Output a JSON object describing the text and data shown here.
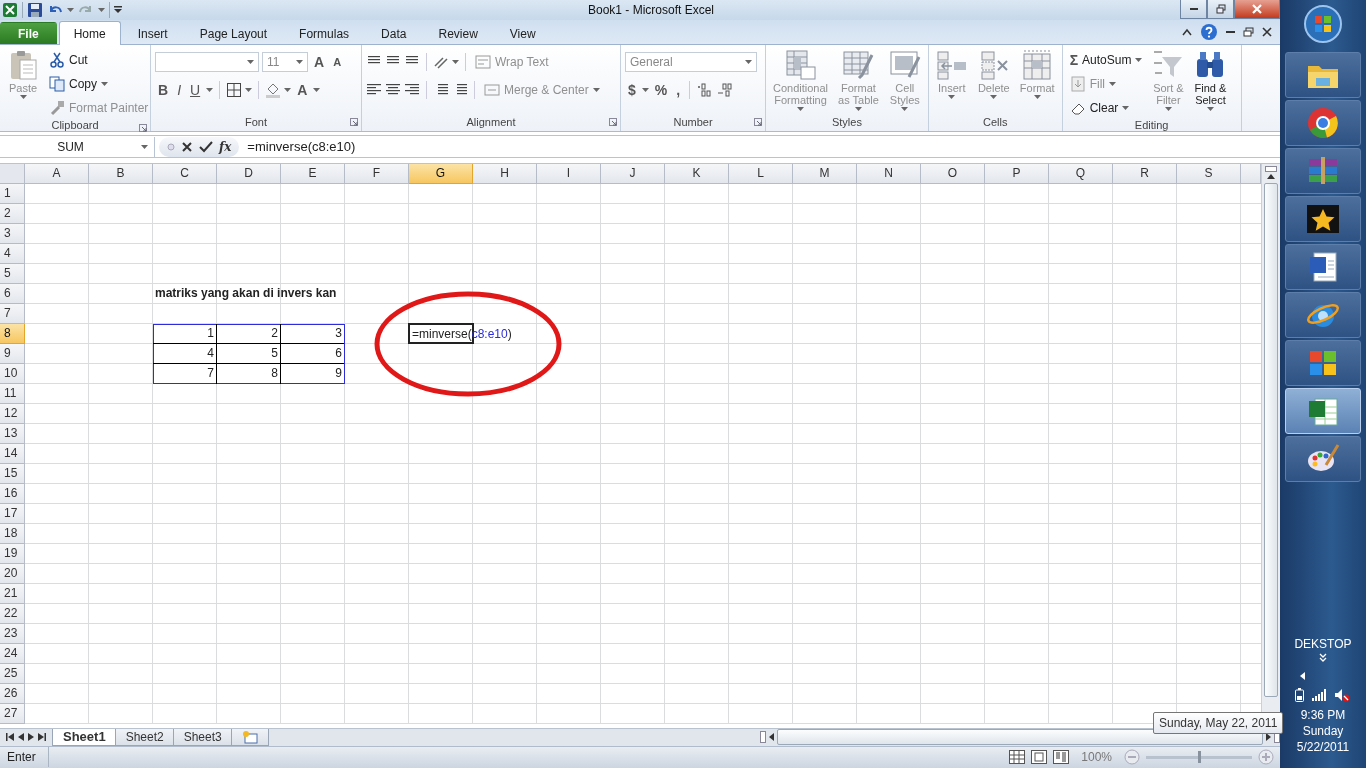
{
  "window": {
    "title": "Book1  -  Microsoft Excel"
  },
  "ribbon_tabs": [
    {
      "label": "File",
      "kind": "file",
      "selected": false
    },
    {
      "label": "Home",
      "kind": "tab",
      "selected": true
    },
    {
      "label": "Insert",
      "kind": "tab",
      "selected": false
    },
    {
      "label": "Page Layout",
      "kind": "tab",
      "selected": false
    },
    {
      "label": "Formulas",
      "kind": "tab",
      "selected": false
    },
    {
      "label": "Data",
      "kind": "tab",
      "selected": false
    },
    {
      "label": "Review",
      "kind": "tab",
      "selected": false
    },
    {
      "label": "View",
      "kind": "tab",
      "selected": false
    }
  ],
  "ribbon": {
    "groups": [
      {
        "kind": "clipboard",
        "label": "Clipboard",
        "paste": {
          "label": "Paste",
          "disabled": true
        },
        "cut": {
          "label": "Cut",
          "disabled": false
        },
        "copy": {
          "label": "Copy",
          "disabled": false
        },
        "format_painter": {
          "label": "Format Painter",
          "disabled": true
        }
      },
      {
        "kind": "font",
        "label": "Font",
        "font_size": "11",
        "grow_font": "A",
        "shrink_font": "A",
        "bold": "B",
        "italic": "I",
        "underline": "U",
        "font_color": "A"
      },
      {
        "kind": "alignment",
        "label": "Alignment",
        "wrap_text": {
          "label": "Wrap Text",
          "disabled": true
        },
        "merge": {
          "label": "Merge & Center",
          "disabled": true
        }
      },
      {
        "kind": "number",
        "label": "Number",
        "format": "General",
        "currency": "$",
        "percent": "%",
        "comma": ","
      },
      {
        "kind": "large",
        "label": "Styles",
        "buttons": [
          {
            "kind": "conditional",
            "label": "Conditional\nFormatting",
            "disabled": true
          },
          {
            "kind": "table",
            "label": "Format\nas Table",
            "disabled": true
          },
          {
            "kind": "styles",
            "label": "Cell\nStyles",
            "disabled": true
          }
        ]
      },
      {
        "kind": "large",
        "label": "Cells",
        "buttons": [
          {
            "kind": "insert",
            "label": "Insert",
            "disabled": true
          },
          {
            "kind": "delete",
            "label": "Delete",
            "disabled": true
          },
          {
            "kind": "format",
            "label": "Format",
            "disabled": true
          }
        ]
      },
      {
        "kind": "editing",
        "label": "Editing",
        "autosum": {
          "glyph": "Σ",
          "label": "AutoSum",
          "disabled": false
        },
        "fill": {
          "label": "Fill",
          "disabled": true
        },
        "clear": {
          "label": "Clear",
          "disabled": false
        },
        "sort": {
          "label": "Sort &\nFilter",
          "disabled": true
        },
        "find": {
          "label": "Find &\nSelect",
          "disabled": false
        }
      }
    ]
  },
  "formula_bar": {
    "name_box": "SUM",
    "function_button": "fx",
    "formula": "=minverse(c8:e10)"
  },
  "sheet": {
    "columns": [
      {
        "label": "A",
        "selected": false
      },
      {
        "label": "B",
        "selected": false
      },
      {
        "label": "C",
        "selected": false
      },
      {
        "label": "D",
        "selected": false
      },
      {
        "label": "E",
        "selected": false
      },
      {
        "label": "F",
        "selected": false
      },
      {
        "label": "G",
        "selected": true
      },
      {
        "label": "H",
        "selected": false
      },
      {
        "label": "I",
        "selected": false
      },
      {
        "label": "J",
        "selected": false
      },
      {
        "label": "K",
        "selected": false
      },
      {
        "label": "L",
        "selected": false
      },
      {
        "label": "M",
        "selected": false
      },
      {
        "label": "N",
        "selected": false
      },
      {
        "label": "O",
        "selected": false
      },
      {
        "label": "P",
        "selected": false
      },
      {
        "label": "Q",
        "selected": false
      },
      {
        "label": "R",
        "selected": false
      },
      {
        "label": "S",
        "selected": false
      }
    ],
    "rows": [
      {
        "label": "1",
        "selected": false
      },
      {
        "label": "2",
        "selected": false
      },
      {
        "label": "3",
        "selected": false
      },
      {
        "label": "4",
        "selected": false
      },
      {
        "label": "5",
        "selected": false
      },
      {
        "label": "6",
        "selected": false,
        "cells": [
          null,
          null,
          {
            "kind": "text",
            "text": "matriks yang akan di invers kan",
            "bold": true
          }
        ]
      },
      {
        "label": "7",
        "selected": false
      },
      {
        "label": "8",
        "selected": true,
        "cells": [
          null,
          null,
          {
            "kind": "number",
            "text": "1",
            "boxed": true,
            "referenced": true
          },
          {
            "kind": "number",
            "text": "2",
            "boxed": true,
            "referenced": true
          },
          {
            "kind": "number",
            "text": "3",
            "boxed": true,
            "referenced": true
          },
          null,
          {
            "kind": "editor",
            "parts": [
              {
                "text": "=minverse(",
                "kind": "plain"
              },
              {
                "text": "c8:e10",
                "kind": "reference"
              },
              {
                "text": ")",
                "kind": "plain"
              }
            ]
          }
        ]
      },
      {
        "label": "9",
        "selected": false,
        "cells": [
          null,
          null,
          {
            "kind": "number",
            "text": "4",
            "boxed": true,
            "referenced": true
          },
          {
            "kind": "number",
            "text": "5",
            "boxed": true,
            "referenced": true
          },
          {
            "kind": "number",
            "text": "6",
            "boxed": true,
            "referenced": true
          }
        ]
      },
      {
        "label": "10",
        "selected": false,
        "cells": [
          null,
          null,
          {
            "kind": "number",
            "text": "7",
            "boxed": true,
            "referenced": true
          },
          {
            "kind": "number",
            "text": "8",
            "boxed": true,
            "referenced": true
          },
          {
            "kind": "number",
            "text": "9",
            "boxed": true,
            "referenced": true
          }
        ]
      },
      {
        "label": "11",
        "selected": false
      },
      {
        "label": "12",
        "selected": false
      },
      {
        "label": "13",
        "selected": false
      },
      {
        "label": "14",
        "selected": false
      },
      {
        "label": "15",
        "selected": false
      },
      {
        "label": "16",
        "selected": false
      },
      {
        "label": "17",
        "selected": false
      },
      {
        "label": "18",
        "selected": false
      },
      {
        "label": "19",
        "selected": false
      },
      {
        "label": "20",
        "selected": false
      },
      {
        "label": "21",
        "selected": false
      },
      {
        "label": "22",
        "selected": false
      },
      {
        "label": "23",
        "selected": false
      },
      {
        "label": "24",
        "selected": false
      },
      {
        "label": "25",
        "selected": false
      },
      {
        "label": "26",
        "selected": false
      },
      {
        "label": "27",
        "selected": false
      }
    ]
  },
  "sheet_tabs": [
    {
      "label": "Sheet1",
      "selected": true
    },
    {
      "label": "Sheet2",
      "selected": false
    },
    {
      "label": "Sheet3",
      "selected": false
    }
  ],
  "status_bar": {
    "mode": "Enter",
    "zoom": "100%",
    "zoom_slider": {
      "level": 0.5
    }
  },
  "taskbar": {
    "apps": [
      {
        "kind": "explorer",
        "selected": false
      },
      {
        "kind": "chrome",
        "selected": false
      },
      {
        "kind": "archive",
        "selected": false
      },
      {
        "kind": "movie",
        "selected": false
      },
      {
        "kind": "word",
        "selected": false
      },
      {
        "kind": "ie",
        "selected": false
      },
      {
        "kind": "windows",
        "selected": false
      },
      {
        "kind": "excel",
        "selected": true
      },
      {
        "kind": "paint",
        "selected": false
      }
    ],
    "desktop_label": "DEKSTOP",
    "time": "9:36 PM",
    "day": "Sunday",
    "date": "5/22/2011"
  },
  "tooltip": {
    "text": "Sunday, May 22, 2011"
  }
}
